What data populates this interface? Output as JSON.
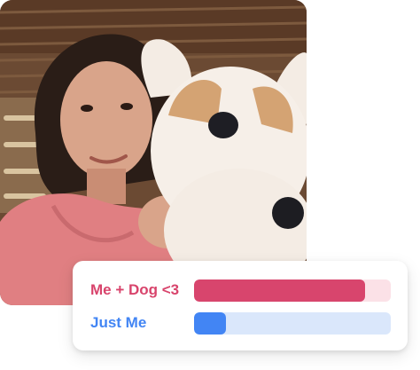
{
  "poll": {
    "options": [
      {
        "label": "Me + Dog <3",
        "fraction": 0.87,
        "text_color": "#d8446c",
        "fill_color": "#d8456d",
        "track_color": "#fbe1e7"
      },
      {
        "label": "Just Me",
        "fraction": 0.16,
        "text_color": "#4285f4",
        "fill_color": "#4285f4",
        "track_color": "#dae7fb"
      }
    ]
  },
  "photo": {
    "subject": "person-holding-plush-corgi"
  }
}
